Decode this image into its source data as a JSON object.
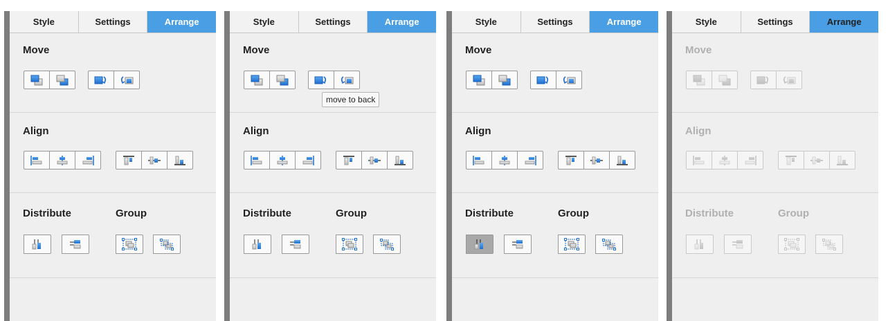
{
  "tabs": [
    "Style",
    "Settings",
    "Arrange"
  ],
  "sections": {
    "move": "Move",
    "align": "Align",
    "distribute": "Distribute",
    "group": "Group"
  },
  "tooltip": "move to back",
  "panels": [
    {
      "state": "normal"
    },
    {
      "state": "tooltip-hover"
    },
    {
      "state": "distribute-pressed"
    },
    {
      "state": "disabled"
    }
  ],
  "colors": {
    "accent": "#4a9ee4",
    "icon_blue": "#1f6fd1",
    "icon_gray": "#c8c8c8"
  },
  "icons": {
    "move": [
      "bring-to-front-icon",
      "send-to-back-icon",
      "move-forward-icon",
      "move-backward-icon"
    ],
    "align": [
      "align-left-icon",
      "align-center-icon",
      "align-right-icon",
      "align-top-icon",
      "align-middle-icon",
      "align-bottom-icon"
    ],
    "distribute": [
      "distribute-horizontal-icon",
      "distribute-vertical-icon"
    ],
    "group": [
      "group-icon",
      "ungroup-icon"
    ]
  }
}
